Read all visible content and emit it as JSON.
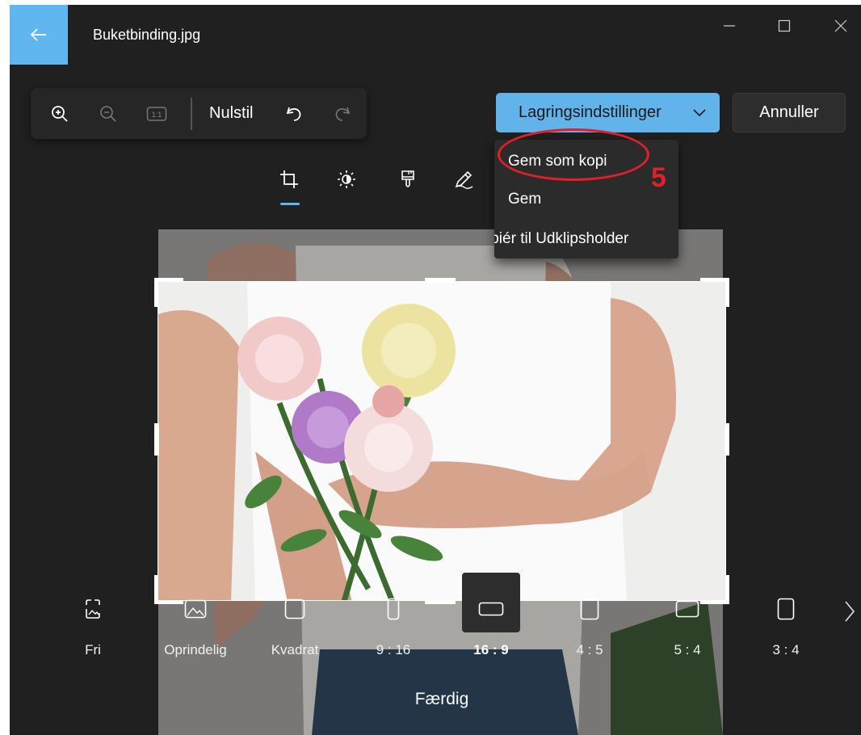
{
  "window": {
    "title": "Buketbinding.jpg",
    "accent_color": "#60b6ee"
  },
  "icons": {
    "back": "arrow-left-icon",
    "minimize": "minimize-icon",
    "maximize": "maximize-icon",
    "close": "close-icon"
  },
  "toolbar": {
    "zoom_in": "zoom-in-icon",
    "zoom_out": "zoom-out-icon",
    "actual_size": "1:1",
    "reset_label": "Nulstil",
    "undo": "undo-icon",
    "redo": "redo-icon"
  },
  "save_button": {
    "label": "Lagringsindstillinger",
    "chevron": "chevron-down-icon"
  },
  "cancel_button": {
    "label": "Annuller"
  },
  "save_menu": {
    "items": [
      {
        "label": "Gem som kopi"
      },
      {
        "label": "Gem"
      },
      {
        "label": "Kopiér til Udklipsholder"
      }
    ]
  },
  "annotation": {
    "number": "5",
    "color": "#e3202a"
  },
  "edit_tabs": [
    {
      "icon": "crop-icon",
      "selected": true
    },
    {
      "icon": "brightness-icon",
      "selected": false
    },
    {
      "icon": "filter-brush-icon",
      "selected": false
    },
    {
      "icon": "markup-pen-icon",
      "selected": false
    }
  ],
  "aspect_ratios": [
    {
      "label": "Fri",
      "icon": "free-ratio-icon",
      "selected": false
    },
    {
      "label": "Oprindelig",
      "icon": "original-ratio-icon",
      "selected": false
    },
    {
      "label": "Kvadrat",
      "icon": "square-ratio-icon",
      "selected": false
    },
    {
      "label": "9 : 16",
      "icon": "ratio-9-16-icon",
      "selected": false
    },
    {
      "label": "16 : 9",
      "icon": "ratio-16-9-icon",
      "selected": true
    },
    {
      "label": "4 : 5",
      "icon": "ratio-4-5-icon",
      "selected": false
    },
    {
      "label": "5 : 4",
      "icon": "ratio-5-4-icon",
      "selected": false
    },
    {
      "label": "3 : 4",
      "icon": "ratio-3-4-icon",
      "selected": false
    }
  ],
  "done_label": "Færdig"
}
